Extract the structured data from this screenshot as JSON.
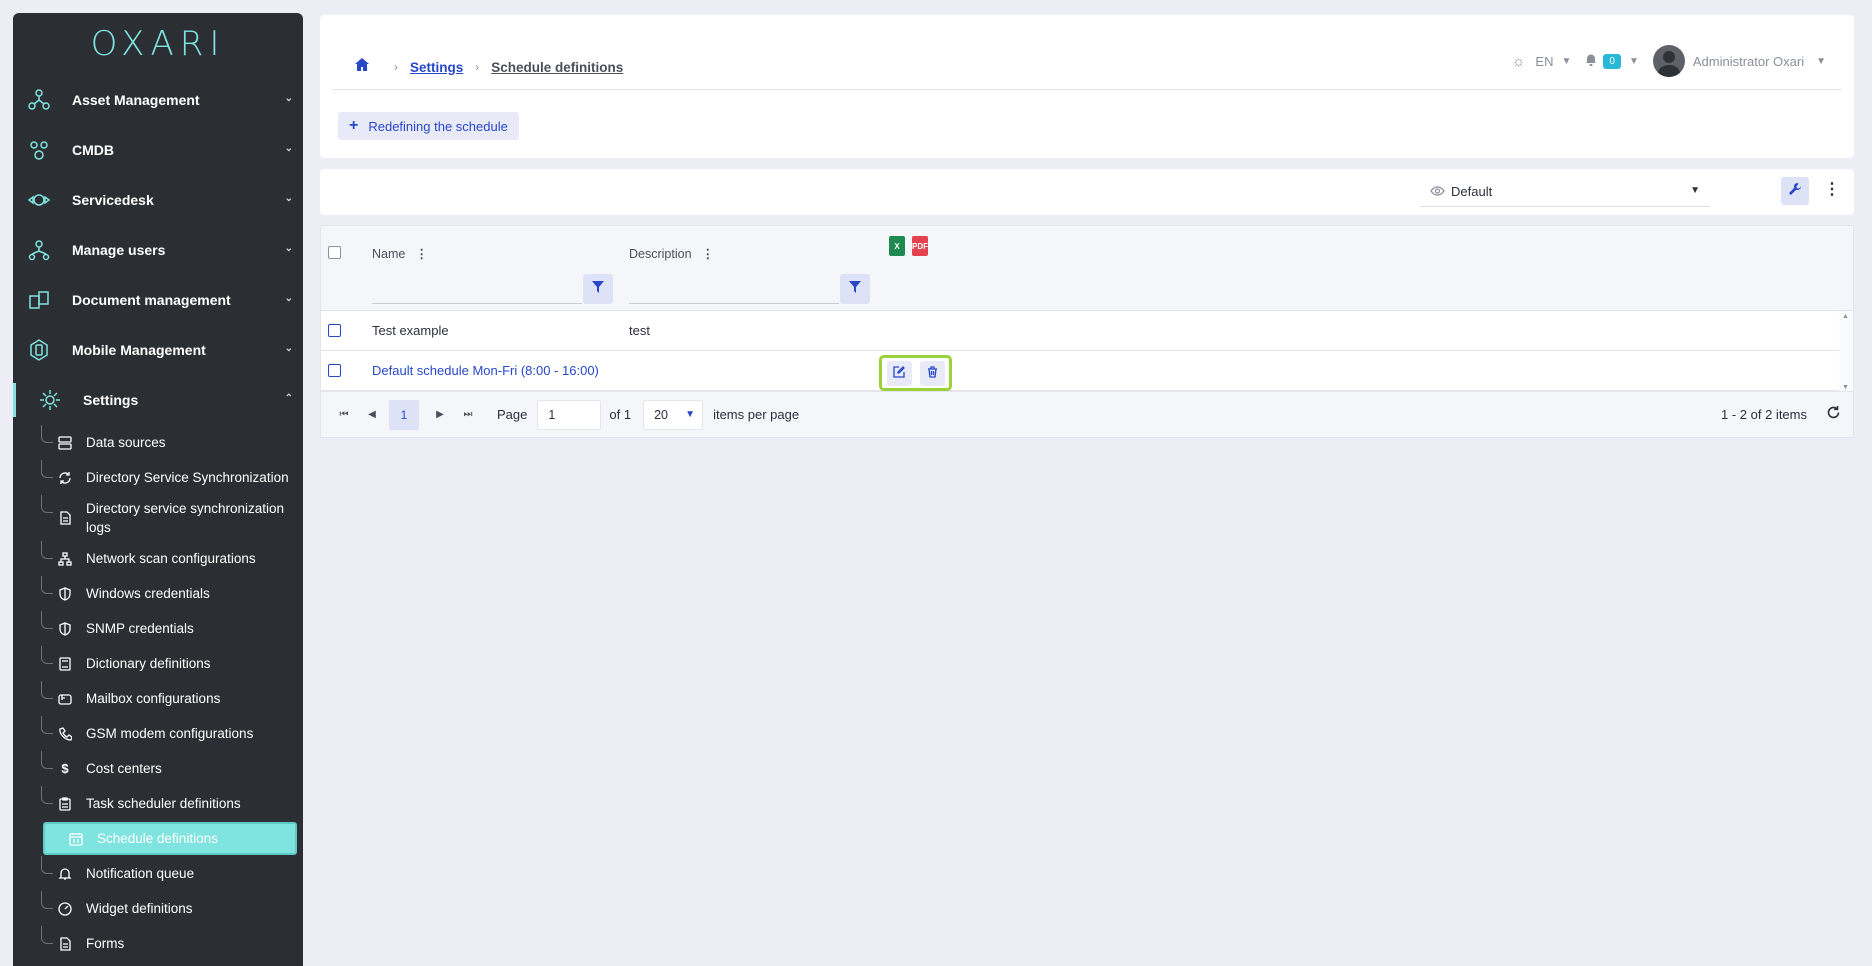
{
  "app": {
    "logo": "OXARI"
  },
  "sidebar": {
    "main_items": [
      {
        "label": "Asset Management",
        "icon": "asset-management-icon"
      },
      {
        "label": "CMDB",
        "icon": "cmdb-icon"
      },
      {
        "label": "Servicedesk",
        "icon": "servicedesk-icon"
      },
      {
        "label": "Manage users",
        "icon": "manage-users-icon"
      },
      {
        "label": "Document management",
        "icon": "document-management-icon"
      },
      {
        "label": "Mobile Management",
        "icon": "mobile-management-icon"
      },
      {
        "label": "Settings",
        "icon": "settings-icon"
      }
    ],
    "settings_items": [
      {
        "label": "Data sources",
        "icon": "database-icon"
      },
      {
        "label": "Directory Service Synchronization",
        "icon": "sync-icon"
      },
      {
        "label": "Directory service synchronization logs",
        "icon": "file-icon"
      },
      {
        "label": "Network scan configurations",
        "icon": "network-icon"
      },
      {
        "label": "Windows credentials",
        "icon": "shield-icon"
      },
      {
        "label": "SNMP credentials",
        "icon": "shield-icon"
      },
      {
        "label": "Dictionary definitions",
        "icon": "book-icon"
      },
      {
        "label": "Mailbox configurations",
        "icon": "mailbox-icon"
      },
      {
        "label": "GSM modem configurations",
        "icon": "phone-icon"
      },
      {
        "label": "Cost centers",
        "icon": "dollar-icon"
      },
      {
        "label": "Task scheduler definitions",
        "icon": "clipboard-icon"
      },
      {
        "label": "Schedule definitions",
        "icon": "calendar-icon"
      },
      {
        "label": "Notification queue",
        "icon": "bell-icon"
      },
      {
        "label": "Widget definitions",
        "icon": "gauge-icon"
      },
      {
        "label": "Forms",
        "icon": "form-icon"
      }
    ],
    "active_item": "Schedule definitions"
  },
  "header": {
    "breadcrumb": {
      "settings": "Settings",
      "current": "Schedule definitions"
    },
    "language": "EN",
    "notifications_count": "0",
    "user_name": "Administrator Oxari",
    "add_button_label": "Redefining the schedule"
  },
  "toolbar": {
    "view_label": "Default"
  },
  "grid": {
    "columns": {
      "name": "Name",
      "description": "Description"
    },
    "export": {
      "xls": "X",
      "pdf": "PDF"
    },
    "rows": [
      {
        "name": "Test example",
        "description": "test"
      },
      {
        "name": "Default schedule Mon-Fri (8:00 - 16:00)",
        "description": ""
      }
    ]
  },
  "pager": {
    "current_page": "1",
    "page_label": "Page",
    "page_input": "1",
    "of_label": "of 1",
    "page_size": "20",
    "items_per_page_label": "items per page",
    "summary": "1 - 2 of 2 items"
  },
  "colors": {
    "accent": "#7fe3e0",
    "link": "#2747c9",
    "sidebar_bg": "#2b2e33",
    "highlight": "#9bd13a"
  }
}
